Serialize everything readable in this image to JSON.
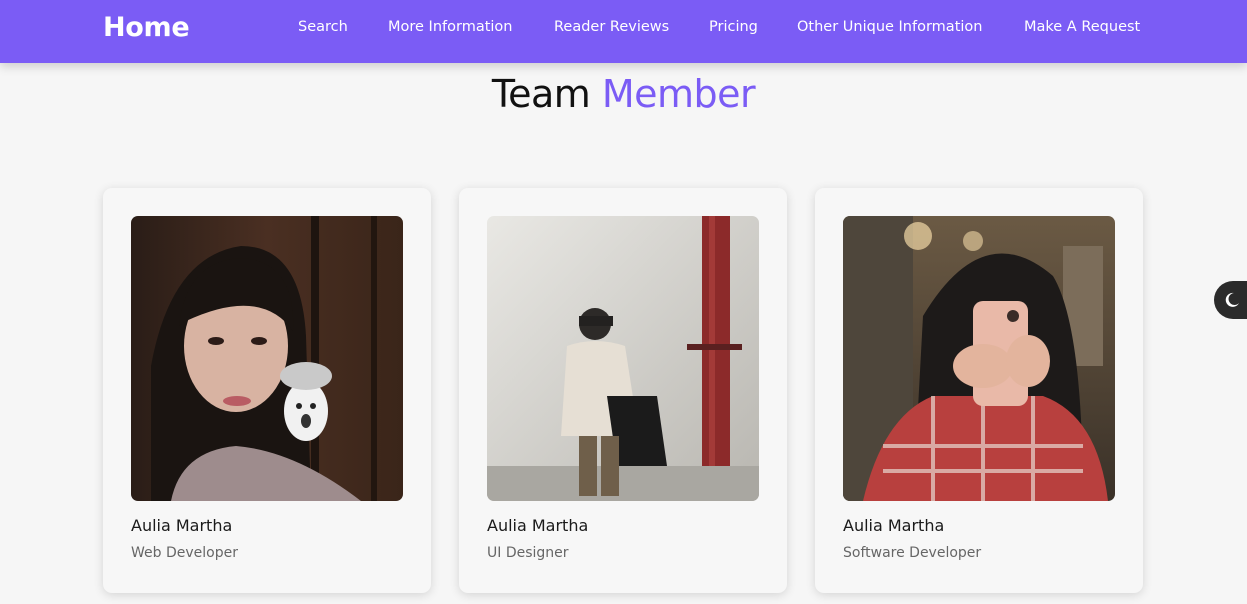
{
  "nav": {
    "brand": "Home",
    "links": [
      "Search",
      "More Information",
      "Reader Reviews",
      "Pricing",
      "Other Unique Information",
      "Make A Request"
    ]
  },
  "section": {
    "title_plain": "Team",
    "title_accent": "Member"
  },
  "team": [
    {
      "name": "Aulia Martha",
      "role": "Web Developer"
    },
    {
      "name": "Aulia Martha",
      "role": "UI Designer"
    },
    {
      "name": "Aulia Martha",
      "role": "Software Developer"
    }
  ],
  "theme_toggle": {
    "icon": "moon-icon"
  },
  "colors": {
    "accent": "#7b5cf5",
    "navbar": "#7b5cf5",
    "background": "#f6f6f6"
  }
}
